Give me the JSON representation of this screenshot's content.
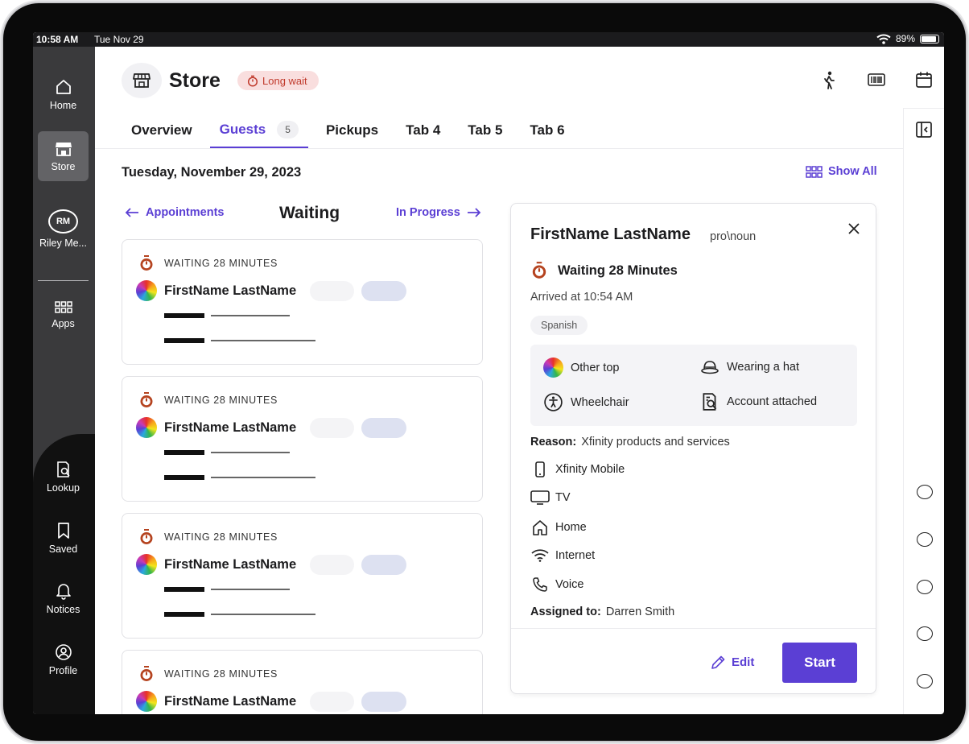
{
  "status_bar": {
    "time": "10:58 AM",
    "date": "Tue Nov 29",
    "battery": "89%",
    "battery_level": 0.89
  },
  "nav": {
    "home": "Home",
    "store": "Store",
    "profile_initials": "RM",
    "profile_name": "Riley Me...",
    "apps": "Apps",
    "lookup": "Lookup",
    "saved": "Saved",
    "notices": "Notices",
    "profile": "Profile"
  },
  "header": {
    "title": "Store",
    "badge": "Long wait"
  },
  "tabs": [
    {
      "label": "Overview"
    },
    {
      "label": "Guests",
      "count": "5"
    },
    {
      "label": "Pickups"
    },
    {
      "label": "Tab 4"
    },
    {
      "label": "Tab 5"
    },
    {
      "label": "Tab 6"
    }
  ],
  "date_heading": "Tuesday, November 29, 2023",
  "show_all": "Show All",
  "column": {
    "prev": "Appointments",
    "current": "Waiting",
    "next": "In Progress"
  },
  "guests": [
    {
      "status": "WAITING 28 MINUTES",
      "name": "FirstName LastName"
    },
    {
      "status": "WAITING 28 MINUTES",
      "name": "FirstName LastName"
    },
    {
      "status": "WAITING 28 MINUTES",
      "name": "FirstName LastName"
    },
    {
      "status": "WAITING 28 MINUTES",
      "name": "FirstName LastName"
    }
  ],
  "detail": {
    "name": "FirstName LastName",
    "pronoun": "pro\\noun",
    "wait": "Waiting 28 Minutes",
    "arrived": "Arrived at 10:54 AM",
    "language": "Spanish",
    "attributes": {
      "top": "Other top",
      "hat": "Wearing a hat",
      "wheelchair": "Wheelchair",
      "account": "Account attached"
    },
    "reason_label": "Reason:",
    "reason_value": "Xfinity products and services",
    "services": {
      "mobile": "Xfinity Mobile",
      "tv": "TV",
      "home": "Home",
      "internet": "Internet",
      "voice": "Voice"
    },
    "assigned_label": "Assigned to:",
    "assigned_value": "Darren Smith",
    "edit": "Edit",
    "start": "Start"
  },
  "colors": {
    "accent": "#5b3fd4",
    "danger": "#c0392b",
    "badge_bg": "#f9dede"
  }
}
